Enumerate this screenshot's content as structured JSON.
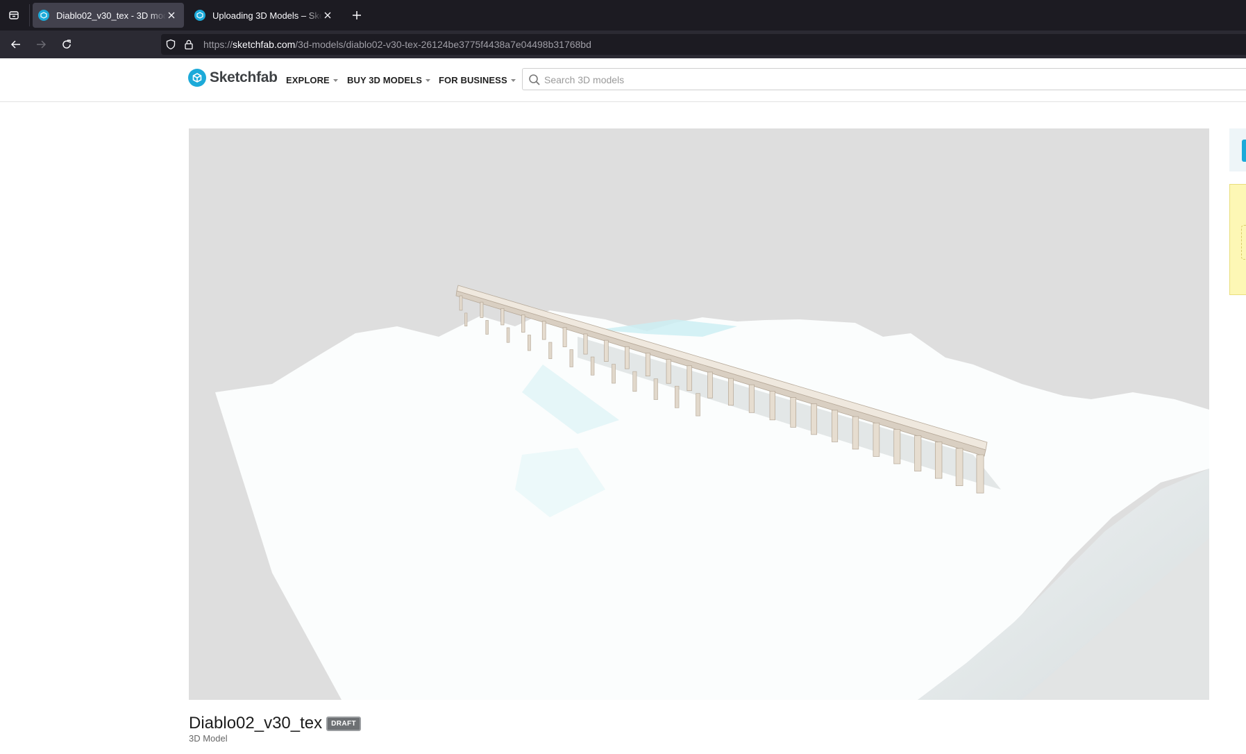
{
  "browser": {
    "tabs": [
      {
        "title": "Diablo02_v30_tex - 3D model by",
        "active": true
      },
      {
        "title": "Uploading 3D Models – Sketchfab",
        "active": false
      }
    ],
    "url_host": "sketchfab.com",
    "url_prefix": "https://",
    "url_path": "/3d-models/diablo02-v30-tex-26124be3775f4438a7e04498b31768bd"
  },
  "header": {
    "brand": "Sketchfab",
    "menu": [
      "EXPLORE",
      "BUY 3D MODELS",
      "FOR BUSINESS"
    ],
    "search_placeholder": "Search 3D models"
  },
  "model": {
    "name": "Diablo02_v30_tex",
    "badge": "DRAFT",
    "type": "3D Model"
  },
  "colors": {
    "brand": "#1caad9",
    "viewer_bg": "#dedede",
    "browser_tabbar": "#1c1b22",
    "browser_toolbar": "#2b2a33"
  },
  "icons": [
    "tab-list-icon",
    "sketchfab-favicon",
    "close-icon",
    "plus-icon",
    "back-arrow-icon",
    "forward-arrow-icon",
    "reload-icon",
    "shield-icon",
    "lock-icon",
    "search-icon",
    "chevron-down-icon"
  ]
}
